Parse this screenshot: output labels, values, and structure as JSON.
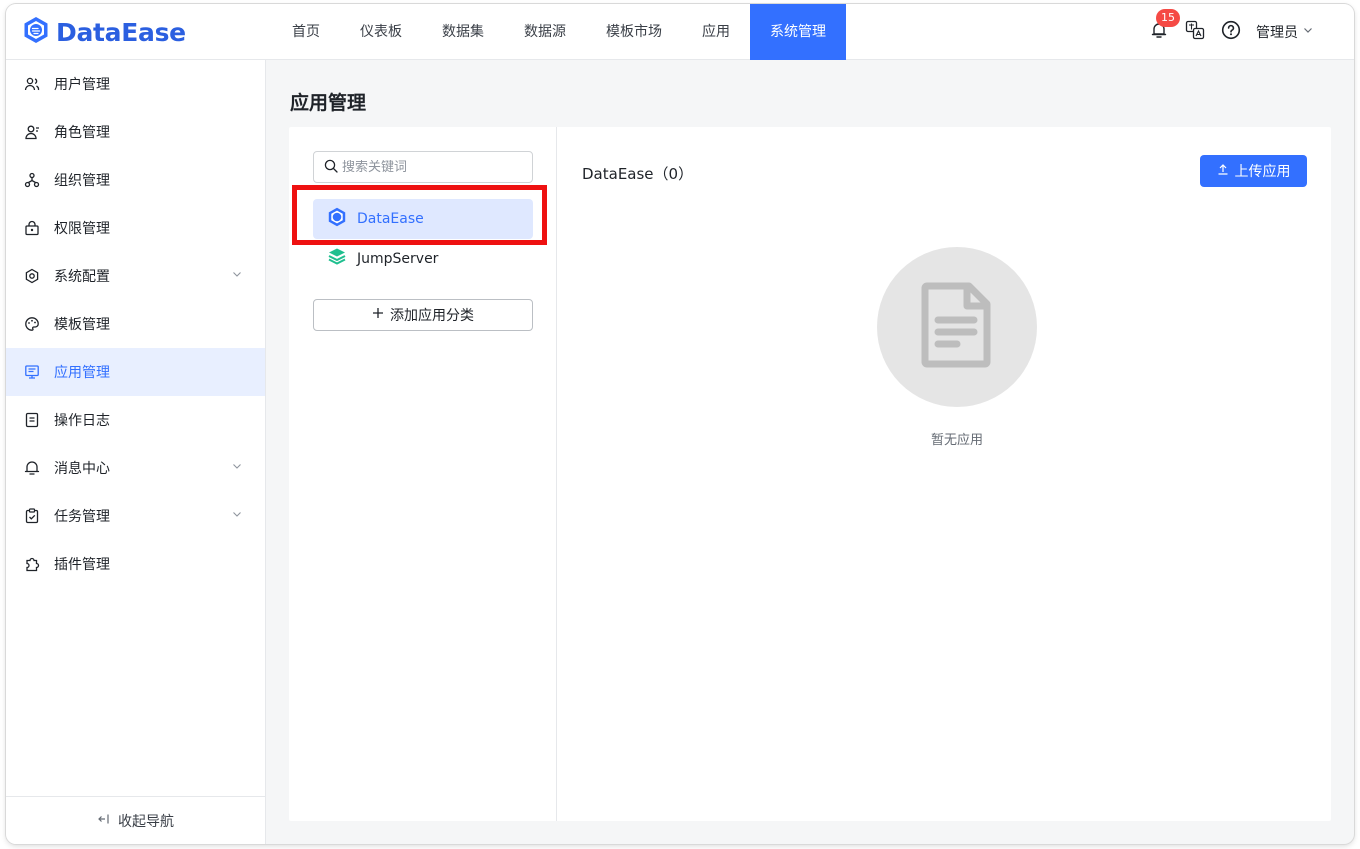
{
  "app": {
    "logo_text": "DataEase",
    "brand_color": "#3370ff"
  },
  "nav": {
    "items": [
      {
        "label": "首页"
      },
      {
        "label": "仪表板"
      },
      {
        "label": "数据集"
      },
      {
        "label": "数据源"
      },
      {
        "label": "模板市场"
      },
      {
        "label": "应用"
      },
      {
        "label": "系统管理"
      }
    ],
    "active": "系统管理"
  },
  "header": {
    "notification_count": "15",
    "user_label": "管理员"
  },
  "sidebar": {
    "items": [
      {
        "label": "用户管理",
        "icon": "users-icon"
      },
      {
        "label": "角色管理",
        "icon": "role-icon"
      },
      {
        "label": "组织管理",
        "icon": "org-icon"
      },
      {
        "label": "权限管理",
        "icon": "lock-icon"
      },
      {
        "label": "系统配置",
        "icon": "gear-icon",
        "expandable": true
      },
      {
        "label": "模板管理",
        "icon": "palette-icon"
      },
      {
        "label": "应用管理",
        "icon": "monitor-icon",
        "active": true
      },
      {
        "label": "操作日志",
        "icon": "document-icon"
      },
      {
        "label": "消息中心",
        "icon": "bell-icon",
        "expandable": true
      },
      {
        "label": "任务管理",
        "icon": "clipboard-icon",
        "expandable": true
      },
      {
        "label": "插件管理",
        "icon": "plugin-icon"
      }
    ],
    "collapse_label": "收起导航"
  },
  "main": {
    "page_title": "应用管理",
    "search": {
      "placeholder": "搜索关键词",
      "value": ""
    },
    "categories": [
      {
        "label": "DataEase",
        "icon": "dataease-logo-icon",
        "selected": true
      },
      {
        "label": "JumpServer",
        "icon": "jumpserver-logo-icon",
        "selected": false
      }
    ],
    "add_category_label": "添加应用分类",
    "right_title": "DataEase（0）",
    "upload_label": "上传应用",
    "empty_text": "暂无应用",
    "highlight_color": "#ee1111"
  }
}
